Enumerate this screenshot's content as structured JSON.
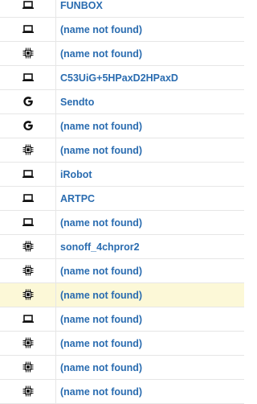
{
  "device_list": {
    "rows": [
      {
        "icon": "laptop-icon",
        "name": "FUNBOX",
        "highlighted": false
      },
      {
        "icon": "laptop-icon",
        "name": "(name not found)",
        "highlighted": false
      },
      {
        "icon": "chip-icon",
        "name": "(name not found)",
        "highlighted": false
      },
      {
        "icon": "laptop-icon",
        "name": "C53UiG+5HPaxD2HPaxD",
        "highlighted": false
      },
      {
        "icon": "google-icon",
        "name": "Sendto",
        "highlighted": false
      },
      {
        "icon": "google-icon",
        "name": "(name not found)",
        "highlighted": false
      },
      {
        "icon": "chip-icon",
        "name": "(name not found)",
        "highlighted": false
      },
      {
        "icon": "laptop-icon",
        "name": "iRobot",
        "highlighted": false
      },
      {
        "icon": "laptop-icon",
        "name": "ARTPC",
        "highlighted": false
      },
      {
        "icon": "laptop-icon",
        "name": "(name not found)",
        "highlighted": false
      },
      {
        "icon": "chip-icon",
        "name": "sonoff_4chpror2",
        "highlighted": false
      },
      {
        "icon": "chip-icon",
        "name": "(name not found)",
        "highlighted": false
      },
      {
        "icon": "chip-icon",
        "name": "(name not found)",
        "highlighted": true
      },
      {
        "icon": "laptop-icon",
        "name": "(name not found)",
        "highlighted": false
      },
      {
        "icon": "chip-icon",
        "name": "(name not found)",
        "highlighted": false
      },
      {
        "icon": "chip-icon",
        "name": "(name not found)",
        "highlighted": false
      },
      {
        "icon": "chip-icon",
        "name": "(name not found)",
        "highlighted": false
      }
    ]
  },
  "colors": {
    "link": "#2a6cb0",
    "highlight_row": "#fcf8d7",
    "border": "#e6e6e6",
    "icon": "#111111"
  }
}
